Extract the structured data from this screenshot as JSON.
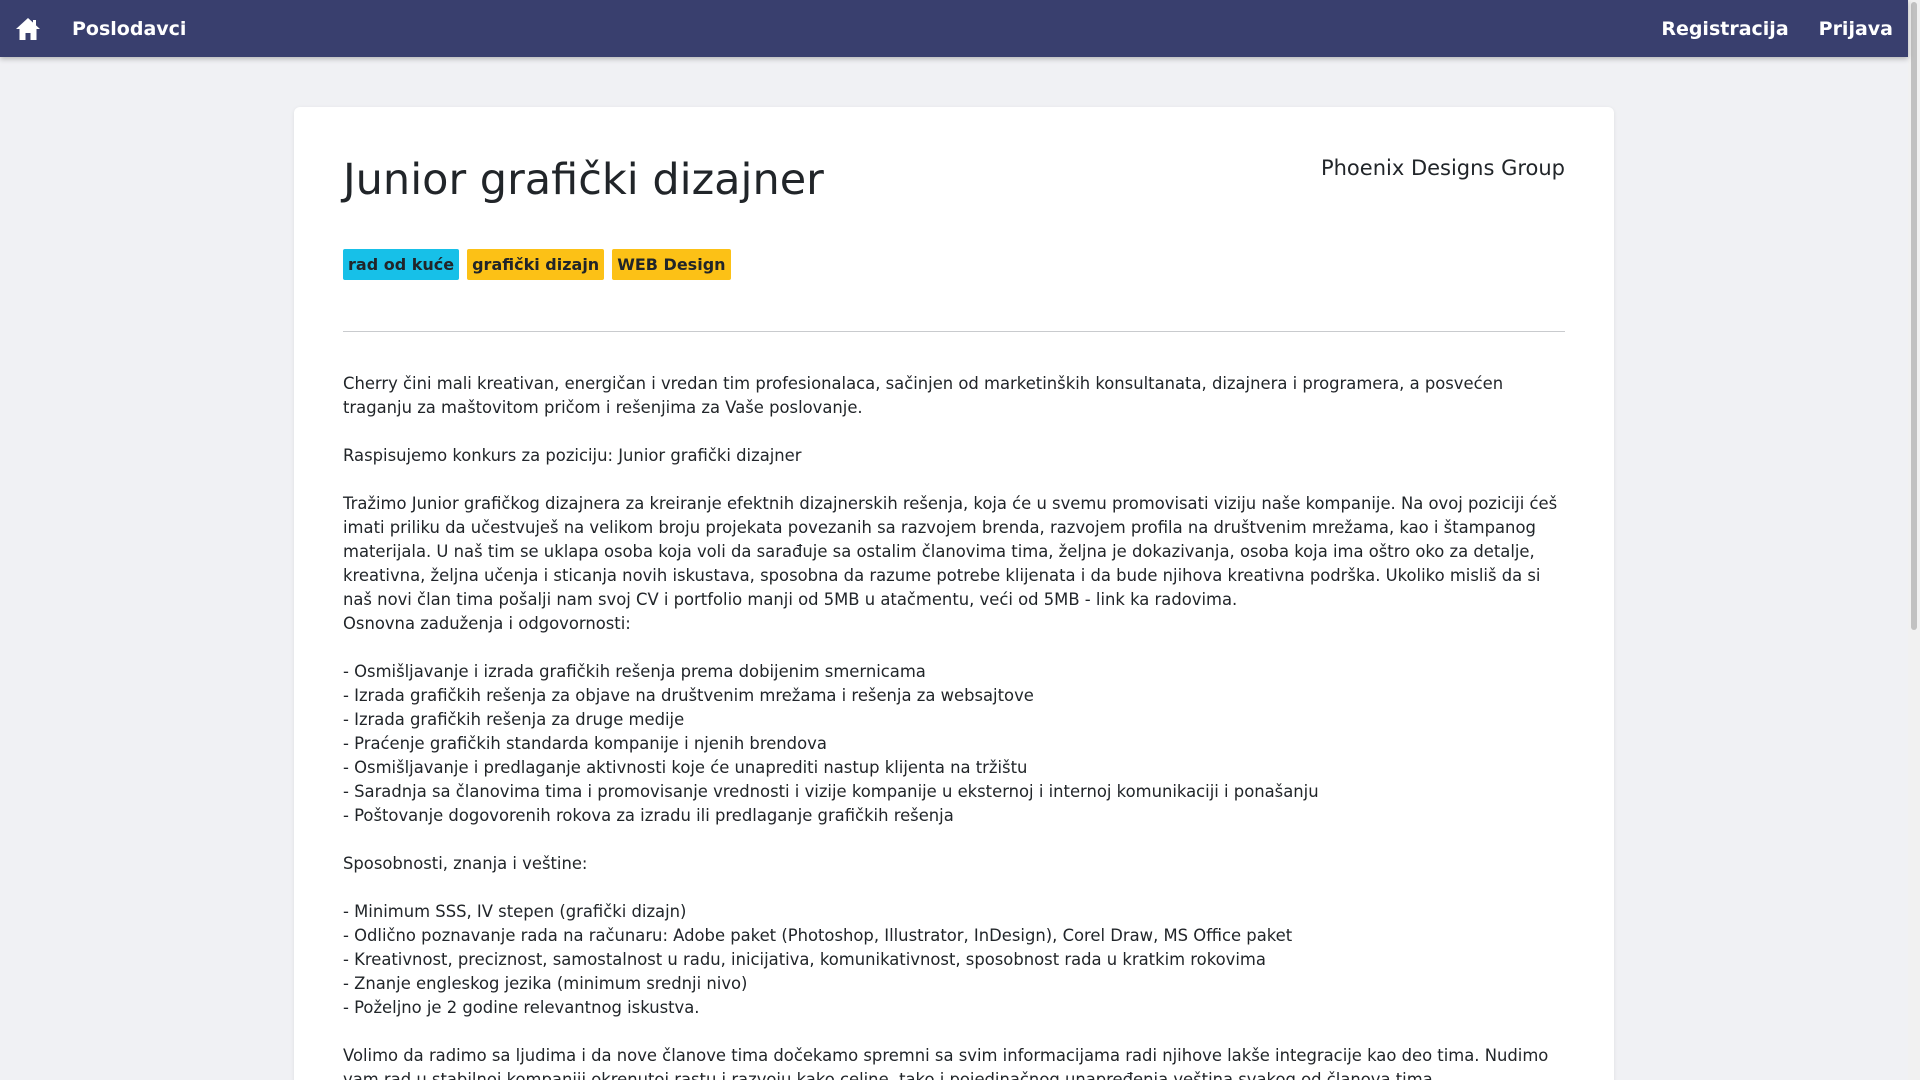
{
  "navbar": {
    "home_icon": "home-icon",
    "brand": "Poslodavci",
    "register": "Registracija",
    "login": "Prijava",
    "background_color": "#393f6e"
  },
  "job": {
    "title": "Junior grafički dizajner",
    "company": "Phoenix Designs Group",
    "tags": [
      {
        "label": "rad od kuće",
        "color": "#17c0e8"
      },
      {
        "label": "grafički dizajn",
        "color": "#fcc116"
      },
      {
        "label": "WEB Design",
        "color": "#fcc116"
      }
    ],
    "description": {
      "intro": "Cherry čini mali kreativan, energičan i vredan tim profesionalaca, sačinjen od marketinških konsultanata, dizajnera i programera, a posvećen traganju za maštovitom pričom i rešenjima za Vaše poslovanje.",
      "position": "Raspisujemo konkurs za poziciju: Junior grafički dizajner",
      "about": "Tražimo Junior grafičkog dizajnera za kreiranje efektnih dizajnerskih rešenja, koja će u svemu promovisati viziju naše kompanije. Na ovoj poziciji ćeš imati priliku da učestvuješ na velikom broju projekata povezanih sa razvojem brenda, razvojem profila na društvenim mrežama, kao i štampanog materijala. U naš tim se uklapa osoba koja voli da sarađuje sa ostalim članovima tima, željna je dokazivanja, osoba koja ima oštro oko za detalje, kreativna, željna učenja i sticanja novih iskustava, sposobna da razume potrebe klijenata i da bude njihova kreativna podrška. Ukoliko misliš da si naš novi član tima pošalji nam svoj CV i portfolio manji od 5MB u atačmentu, veći od 5MB - link ka radovima.",
      "duties_heading": "Osnovna zaduženja i odgovornosti:",
      "duties": [
        "- Osmišljavanje i izrada grafičkih rešenja prema dobijenim smernicama",
        "- Izrada grafičkih rešenja za objave na društvenim mrežama i rešenja za websajtove",
        "- Izrada grafičkih rešenja za druge medije",
        "- Praćenje grafičkih standarda kompanije i njenih brendova",
        "- Osmišljavanje i predlaganje aktivnosti koje će unaprediti nastup klijenta na tržištu",
        "- Saradnja sa članovima tima i promovisanje vrednosti i vizije kompanije u eksternoj i internoj komunikaciji i ponašanju",
        "- Poštovanje dogovorenih rokova za izradu ili predlaganje grafičkih rešenja"
      ],
      "skills_heading": "Sposobnosti, znanja i veštine:",
      "skills": [
        "- Minimum SSS, IV stepen (grafički dizajn)",
        "- Odlično poznavanje rada na računaru: Adobe paket (Photoshop, Illustrator, InDesign), Corel Draw, MS Office paket",
        "- Kreativnost, preciznost, samostalnost u radu, inicijativa, komunikativnost, sposobnost rada u kratkim rokovima",
        "- Znanje engleskog jezika (minimum srednji nivo)",
        "- Poželjno je 2 godine relevantnog iskustva."
      ],
      "closing": "Volimo da radimo sa ljudima i da nove članove tima dočekamo spremni sa svim informacijama radi njihove lakše integracije kao deo tima. Nudimo vam rad u stabilnoj kompaniji okrenutoj rastu i razvoju kako celine, tako i pojedinačnog unapređenja veština svakog od članova tima."
    }
  }
}
